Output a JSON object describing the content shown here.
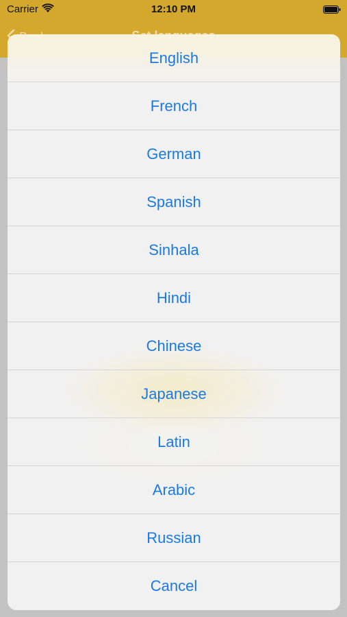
{
  "status_bar": {
    "carrier": "Carrier",
    "time": "12:10 PM",
    "wifi_icon": "wifi-icon",
    "battery_icon": "battery-icon"
  },
  "nav_bar": {
    "back_label": "Back",
    "title": "Set languages",
    "back_icon": "chevron-left-icon"
  },
  "action_sheet": {
    "items": [
      {
        "label": "English"
      },
      {
        "label": "French"
      },
      {
        "label": "German"
      },
      {
        "label": "Spanish"
      },
      {
        "label": "Sinhala"
      },
      {
        "label": "Hindi"
      },
      {
        "label": "Chinese"
      },
      {
        "label": "Japanese"
      },
      {
        "label": "Latin"
      },
      {
        "label": "Arabic"
      },
      {
        "label": "Russian"
      },
      {
        "label": "Cancel"
      }
    ]
  },
  "colors": {
    "nav_background": "#d3a82c",
    "action_text": "#1a7ae0",
    "sheet_background": "#f3f3f3",
    "dim_overlay": "#c2c2c2"
  }
}
